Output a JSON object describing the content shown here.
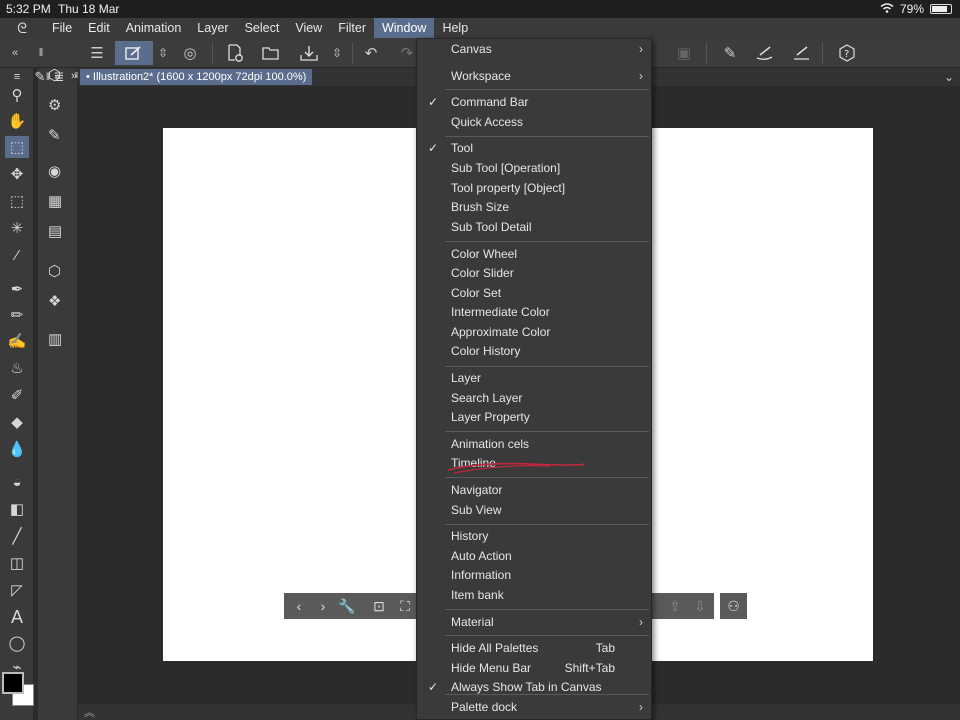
{
  "status_bar": {
    "time": "5:32 PM",
    "date": "Thu 18 Mar",
    "battery": "79%",
    "battery_level": 0.79
  },
  "menubar": {
    "items": [
      "File",
      "Edit",
      "Animation",
      "Layer",
      "Select",
      "View",
      "Filter",
      "Window",
      "Help"
    ],
    "active": "Window"
  },
  "document_tab": {
    "title": "Illustration2* (1600 x 1200px 72dpi 100.0%)"
  },
  "window_menu": {
    "items": [
      {
        "label": "Canvas",
        "submenu": true
      },
      {
        "label": "Workspace",
        "submenu": true
      },
      {
        "label": "Command Bar",
        "checked": true
      },
      {
        "label": "Quick Access"
      },
      {
        "label": "Tool",
        "checked": true
      },
      {
        "label": "Sub Tool [Operation]"
      },
      {
        "label": "Tool property [Object]"
      },
      {
        "label": "Brush Size"
      },
      {
        "label": "Sub Tool Detail"
      },
      {
        "label": "Color Wheel"
      },
      {
        "label": "Color Slider"
      },
      {
        "label": "Color Set"
      },
      {
        "label": "Intermediate Color"
      },
      {
        "label": "Approximate Color"
      },
      {
        "label": "Color History"
      },
      {
        "label": "Layer"
      },
      {
        "label": "Search Layer"
      },
      {
        "label": "Layer Property"
      },
      {
        "label": "Animation cels"
      },
      {
        "label": "Timeline"
      },
      {
        "label": "Navigator"
      },
      {
        "label": "Sub View"
      },
      {
        "label": "History"
      },
      {
        "label": "Auto Action"
      },
      {
        "label": "Information"
      },
      {
        "label": "Item bank"
      },
      {
        "label": "Material",
        "submenu": true
      },
      {
        "label": "Hide All Palettes",
        "shortcut": "Tab"
      },
      {
        "label": "Hide Menu Bar",
        "shortcut": "Shift+Tab"
      },
      {
        "label": "Always Show Tab in Canvas",
        "checked": true
      },
      {
        "label": "Palette dock",
        "submenu": true
      }
    ]
  },
  "colors": {
    "accent": "#5b6d8c",
    "menu_bg": "#3a3a3a",
    "annotation": "#c0283c",
    "foreground_color": "#000000",
    "background_color": "#ffffff"
  },
  "icons": {
    "toolbar": [
      "menu-icon",
      "canvas-select-icon",
      "reorder-icon",
      "spiral-icon",
      "new-doc-icon",
      "open-folder-icon",
      "save-icon",
      "undo-icon",
      "redo-icon",
      "frame-icon",
      "pen-icon",
      "brush-icon",
      "ruler-icon",
      "help-icon"
    ],
    "tools": [
      "zoom-icon",
      "hand-icon",
      "operation-icon",
      "move-icon",
      "selection-icon",
      "magic-wand-icon",
      "eyedropper-icon",
      "pen-icon",
      "pencil-icon",
      "brush-icon",
      "airbrush-icon",
      "decoration-icon",
      "eraser-icon",
      "blend-icon",
      "fill-icon",
      "gradient-icon",
      "line-icon",
      "frame-border-icon",
      "ruler-icon",
      "text-icon",
      "balloon-icon",
      "correct-line-icon"
    ]
  }
}
